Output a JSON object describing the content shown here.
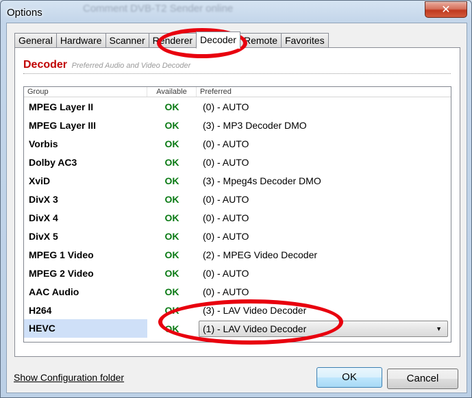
{
  "window": {
    "title": "Options",
    "ghost_title": "Comment DVB-T2 Sender online",
    "close_label": "✕"
  },
  "tabs": [
    {
      "label": "General",
      "active": false
    },
    {
      "label": "Hardware",
      "active": false
    },
    {
      "label": "Scanner",
      "active": false
    },
    {
      "label": "Renderer",
      "active": false
    },
    {
      "label": "Decoder",
      "active": true
    },
    {
      "label": "Remote",
      "active": false
    },
    {
      "label": "Favorites",
      "active": false
    }
  ],
  "section": {
    "title": "Decoder",
    "subtitle": "Preferred Audio and Video Decoder"
  },
  "list": {
    "columns": {
      "group": "Group",
      "available": "Available",
      "preferred": "Preferred"
    },
    "rows": [
      {
        "group": "MPEG Layer II",
        "available": "OK",
        "preferred": "(0) - AUTO"
      },
      {
        "group": "MPEG Layer III",
        "available": "OK",
        "preferred": "(3) - MP3 Decoder DMO"
      },
      {
        "group": "Vorbis",
        "available": "OK",
        "preferred": "(0) - AUTO"
      },
      {
        "group": "Dolby AC3",
        "available": "OK",
        "preferred": "(0) - AUTO"
      },
      {
        "group": "XviD",
        "available": "OK",
        "preferred": "(3) - Mpeg4s Decoder DMO"
      },
      {
        "group": "DivX 3",
        "available": "OK",
        "preferred": "(0) - AUTO"
      },
      {
        "group": "DivX 4",
        "available": "OK",
        "preferred": "(0) - AUTO"
      },
      {
        "group": "DivX 5",
        "available": "OK",
        "preferred": "(0) - AUTO"
      },
      {
        "group": "MPEG 1 Video",
        "available": "OK",
        "preferred": "(2) - MPEG Video Decoder"
      },
      {
        "group": "MPEG 2 Video",
        "available": "OK",
        "preferred": "(0) - AUTO"
      },
      {
        "group": "AAC Audio",
        "available": "OK",
        "preferred": "(0) - AUTO"
      },
      {
        "group": "H264",
        "available": "OK",
        "preferred": "(3) - LAV Video Decoder"
      }
    ],
    "selected_row": {
      "group": "HEVC",
      "available": "OK",
      "preferred": "(1) - LAV Video Decoder"
    }
  },
  "footer": {
    "link_label": "Show Configuration folder",
    "ok_label": "OK",
    "cancel_label": "Cancel"
  },
  "colors": {
    "section_title": "#c00000",
    "available_ok": "#0a7a14",
    "annotation": "#e8000e",
    "selection": "#cfe0f8"
  }
}
